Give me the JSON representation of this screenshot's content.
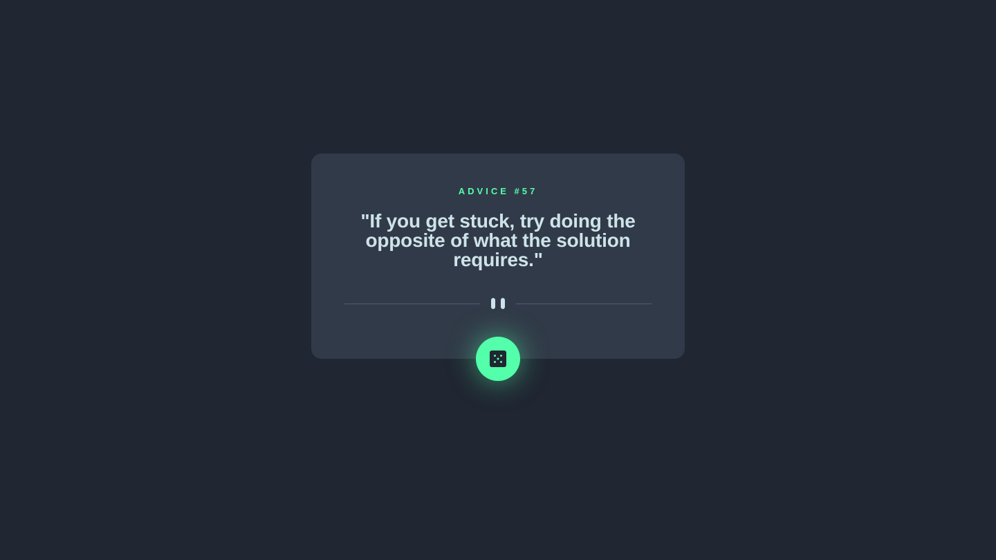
{
  "card": {
    "advice_label": "ADVICE #57",
    "quote": "\"If you get stuck, try doing the opposite of what the solution requires.\""
  },
  "divider": {
    "icon": "pause-icon"
  },
  "button": {
    "icon": "dice-icon",
    "aria_label": "Get new advice"
  },
  "colors": {
    "background": "#202632",
    "card": "#313a48",
    "accent": "#53ffaa",
    "text": "#cee3e9",
    "divider": "#4f5d74"
  }
}
